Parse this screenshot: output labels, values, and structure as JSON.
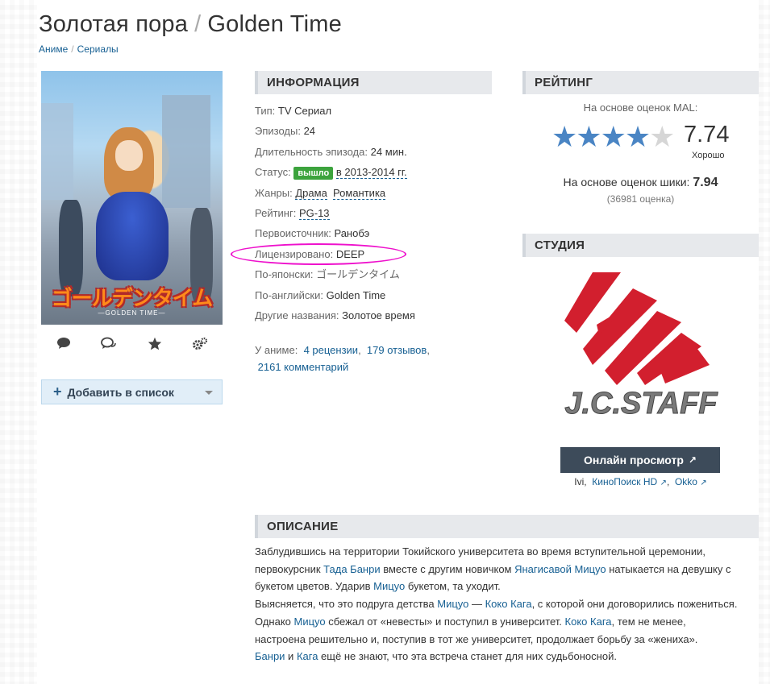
{
  "title": {
    "ru": "Золотая пора",
    "separator": "/",
    "en": "Golden Time"
  },
  "breadcrumb": [
    "Аниме",
    "Сериалы"
  ],
  "poster": {
    "jp_title": "ゴールデンタイム",
    "sub_title": "—GOLDEN TIME—"
  },
  "actions": [
    "comment-icon",
    "comments-icon",
    "star-icon",
    "settings-icon"
  ],
  "add_to_list": "Добавить в список",
  "info": {
    "header": "ИНФОРМАЦИЯ",
    "type_k": "Тип:",
    "type_v": "TV Сериал",
    "episodes_k": "Эпизоды:",
    "episodes_v": "24",
    "duration_k": "Длительность эпизода:",
    "duration_v": "24 мин.",
    "status_k": "Статус:",
    "status_badge": "вышло",
    "status_v": "в 2013-2014 гг.",
    "genres_k": "Жанры:",
    "genre1": "Драма",
    "genre2": "Романтика",
    "rating_k": "Рейтинг:",
    "rating_v": "PG-13",
    "source_k": "Первоисточник:",
    "source_v": "Ранобэ",
    "licensed_k": "Лицензировано:",
    "licensed_v": "DEEP",
    "jp_k": "По-японски:",
    "jp_v": "ゴールデンタイム",
    "en_k": "По-английски:",
    "en_v": "Golden Time",
    "other_k": "Другие названия:",
    "other_v": "Золотое время"
  },
  "reviews": {
    "prefix": "У аниме:",
    "reviews": "4 рецензии",
    "comma": ",",
    "opinions": "179 отзывов",
    "comments": "2161 комментарий"
  },
  "rating": {
    "header": "РЕЙТИНГ",
    "mal_label": "На основе оценок MAL:",
    "score": "7.74",
    "stars_filled": 4,
    "stars_total": 5,
    "score_text": "Хорошо",
    "shiki_label": "На основе оценок шики:",
    "shiki_score": "7.94",
    "shiki_count": "(36981 оценка)"
  },
  "studio": {
    "header": "СТУДИЯ",
    "name": "J.C.STAFF"
  },
  "watch": {
    "button": "Онлайн просмотр",
    "ext": "↗",
    "providers": [
      "Ivi",
      "КиноПоиск HD",
      "Okko"
    ]
  },
  "description": {
    "header": "ОПИСАНИЕ",
    "p1a": "Заблудившись на территории Токийского университета во время вступительной церемонии, первокурсник ",
    "p1_l1": "Тада Банри",
    "p1b": " вместе с другим новичком ",
    "p1_l2": "Янагисавой Мицуо",
    "p1c": " натыкается на девушку с букетом цветов. Ударив ",
    "p1_l3": "Мицуо",
    "p1d": " букетом, та уходит.",
    "p2a": "Выясняется, что это подруга детства ",
    "p2_l1": "Мицуо",
    "p2b": " — ",
    "p2_l2": "Коко Кага",
    "p2c": ", с которой они договорились пожениться. Однако ",
    "p2_l3": "Мицуо",
    "p2d": " сбежал от «невесты» и поступил в университет. ",
    "p2_l4": "Коко Кага",
    "p2e": ", тем не менее, настроена решительно и, поступив в тот же университет, продолжает борьбу за «жениха».",
    "p3_l1": "Банри",
    "p3a": " и ",
    "p3_l2": "Кага",
    "p3b": " ещё не знают, что эта встреча станет для них судьбоносной."
  },
  "colors": {
    "link": "#176093",
    "badge": "#3ca33d",
    "star_filled": "#4a85c4",
    "star_empty": "#d6d6d6",
    "highlight": "#ee11cc",
    "studio_red": "#d21f2e"
  }
}
